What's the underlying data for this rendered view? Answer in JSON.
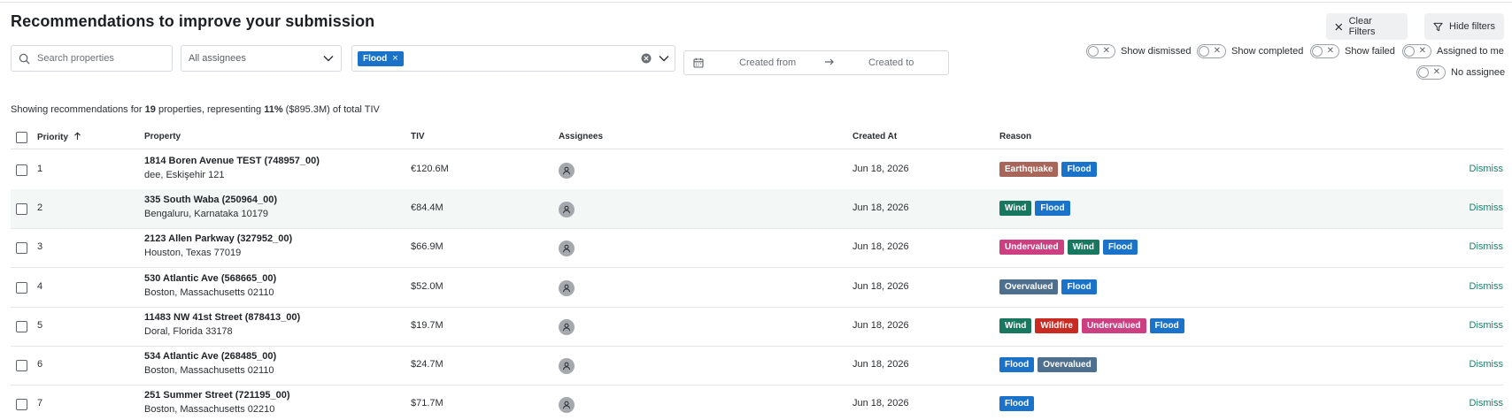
{
  "page": {
    "title": "Recommendations to improve your submission"
  },
  "toolbar": {
    "clear_filters_label": "Clear Filters",
    "hide_filters_label": "Hide filters"
  },
  "filters": {
    "search_placeholder": "Search properties",
    "assignees_value": "All assignees",
    "reason_chip": "Flood",
    "created_from_placeholder": "Created from",
    "created_to_placeholder": "Created to"
  },
  "toggles": [
    {
      "label": "Show dismissed",
      "on": false
    },
    {
      "label": "Show completed",
      "on": false
    },
    {
      "label": "Show failed",
      "on": false
    },
    {
      "label": "Assigned to me",
      "on": false
    },
    {
      "label": "No assignee",
      "on": false
    }
  ],
  "summary": {
    "prefix": "Showing recommendations for ",
    "count": "19",
    "mid1": " properties, representing ",
    "percent": "11%",
    "mid2": " ($895.3M) of total TIV"
  },
  "table": {
    "columns": {
      "priority": "Priority",
      "property": "Property",
      "tiv": "TIV",
      "assignees": "Assignees",
      "created_at": "Created At",
      "reason": "Reason"
    },
    "dismiss_label": "Dismiss",
    "rows": [
      {
        "priority": "1",
        "name": "1814 Boren Avenue TEST (748957_00)",
        "location": "dee, Eskişehir 121",
        "tiv": "€120.6M",
        "created": "Jun 18, 2026",
        "tags": [
          "Earthquake",
          "Flood"
        ]
      },
      {
        "priority": "2",
        "name": "335 South Waba (250964_00)",
        "location": "Bengaluru, Karnataka 10179",
        "tiv": "€84.4M",
        "created": "Jun 18, 2026",
        "tags": [
          "Wind",
          "Flood"
        ]
      },
      {
        "priority": "3",
        "name": "2123 Allen Parkway (327952_00)",
        "location": "Houston, Texas 77019",
        "tiv": "$66.9M",
        "created": "Jun 18, 2026",
        "tags": [
          "Undervalued",
          "Wind",
          "Flood"
        ]
      },
      {
        "priority": "4",
        "name": "530 Atlantic Ave (568665_00)",
        "location": "Boston, Massachusetts 02110",
        "tiv": "$52.0M",
        "created": "Jun 18, 2026",
        "tags": [
          "Overvalued",
          "Flood"
        ]
      },
      {
        "priority": "5",
        "name": "11483 NW 41st Street (878413_00)",
        "location": "Doral, Florida 33178",
        "tiv": "$19.7M",
        "created": "Jun 18, 2026",
        "tags": [
          "Wind",
          "Wildfire",
          "Undervalued",
          "Flood"
        ]
      },
      {
        "priority": "6",
        "name": "534 Atlantic Ave (268485_00)",
        "location": "Boston, Massachusetts 02110",
        "tiv": "$24.7M",
        "created": "Jun 18, 2026",
        "tags": [
          "Flood",
          "Overvalued"
        ]
      },
      {
        "priority": "7",
        "name": "251 Summer Street (721195_00)",
        "location": "Boston, Massachusetts 02210",
        "tiv": "$71.7M",
        "created": "Jun 18, 2026",
        "tags": [
          "Flood"
        ]
      }
    ]
  },
  "tag_colors": {
    "Earthquake": "#a8665a",
    "Flood": "#1a73c8",
    "Wind": "#17775f",
    "Undervalued": "#cc3f80",
    "Overvalued": "#4f6f8f",
    "Wildfire": "#c92b23"
  },
  "accent_colors": {
    "dismiss_link": "#1b7f6b",
    "row_highlight": "#f3f8f7"
  }
}
